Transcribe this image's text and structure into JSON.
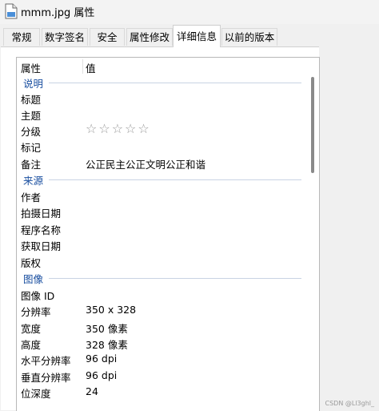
{
  "window": {
    "title": "mmm.jpg 属性",
    "icon": "file-icon"
  },
  "tabs": [
    "常规",
    "数字签名",
    "安全",
    "属性修改",
    "详细信息",
    "以前的版本"
  ],
  "active_tab": "详细信息",
  "list": {
    "columns": {
      "property": "属性",
      "value": "值"
    },
    "groups": {
      "description": {
        "label": "说明",
        "title_key": "标题",
        "subject_key": "主题",
        "rating_key": "分级",
        "rating_value": "☆☆☆☆☆",
        "tags_key": "标记",
        "comment_key": "备注",
        "comment_value": "公正民主公正文明公正和谐"
      },
      "origin": {
        "label": "来源",
        "author_key": "作者",
        "date_taken_key": "拍摄日期",
        "program_key": "程序名称",
        "date_acquired_key": "获取日期",
        "copyright_key": "版权"
      },
      "image": {
        "label": "图像",
        "id_key": "图像 ID",
        "dimensions_key": "分辨率",
        "dimensions_value": "350 x 328",
        "width_key": "宽度",
        "width_value": "350 像素",
        "height_key": "高度",
        "height_value": "328 像素",
        "hres_key": "水平分辨率",
        "hres_value": "96 dpi",
        "vres_key": "垂直分辨率",
        "vres_value": "96 dpi",
        "depth_key": "位深度",
        "depth_value": "24"
      }
    }
  },
  "watermark": "CSDN @Ll3ghl_"
}
